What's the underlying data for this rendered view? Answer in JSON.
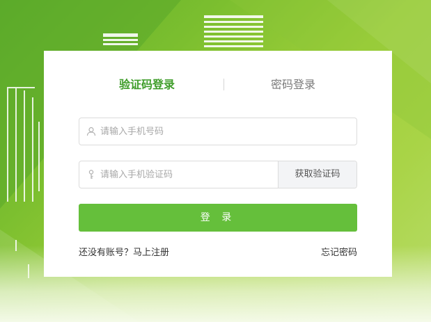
{
  "tabs": {
    "sms_login": "验证码登录",
    "password_login": "密码登录"
  },
  "form": {
    "phone_placeholder": "请输入手机号码",
    "code_placeholder": "请输入手机验证码",
    "get_code_label": "获取验证码",
    "login_label": "登 录"
  },
  "links": {
    "register": "还没有账号？马上注册",
    "forgot_password": "忘记密码"
  },
  "icons": {
    "phone_field": "user-icon",
    "code_field": "key-icon"
  },
  "colors": {
    "accent": "#3f9d2a",
    "button": "#65bf3b",
    "background": "#7cbf2f"
  }
}
